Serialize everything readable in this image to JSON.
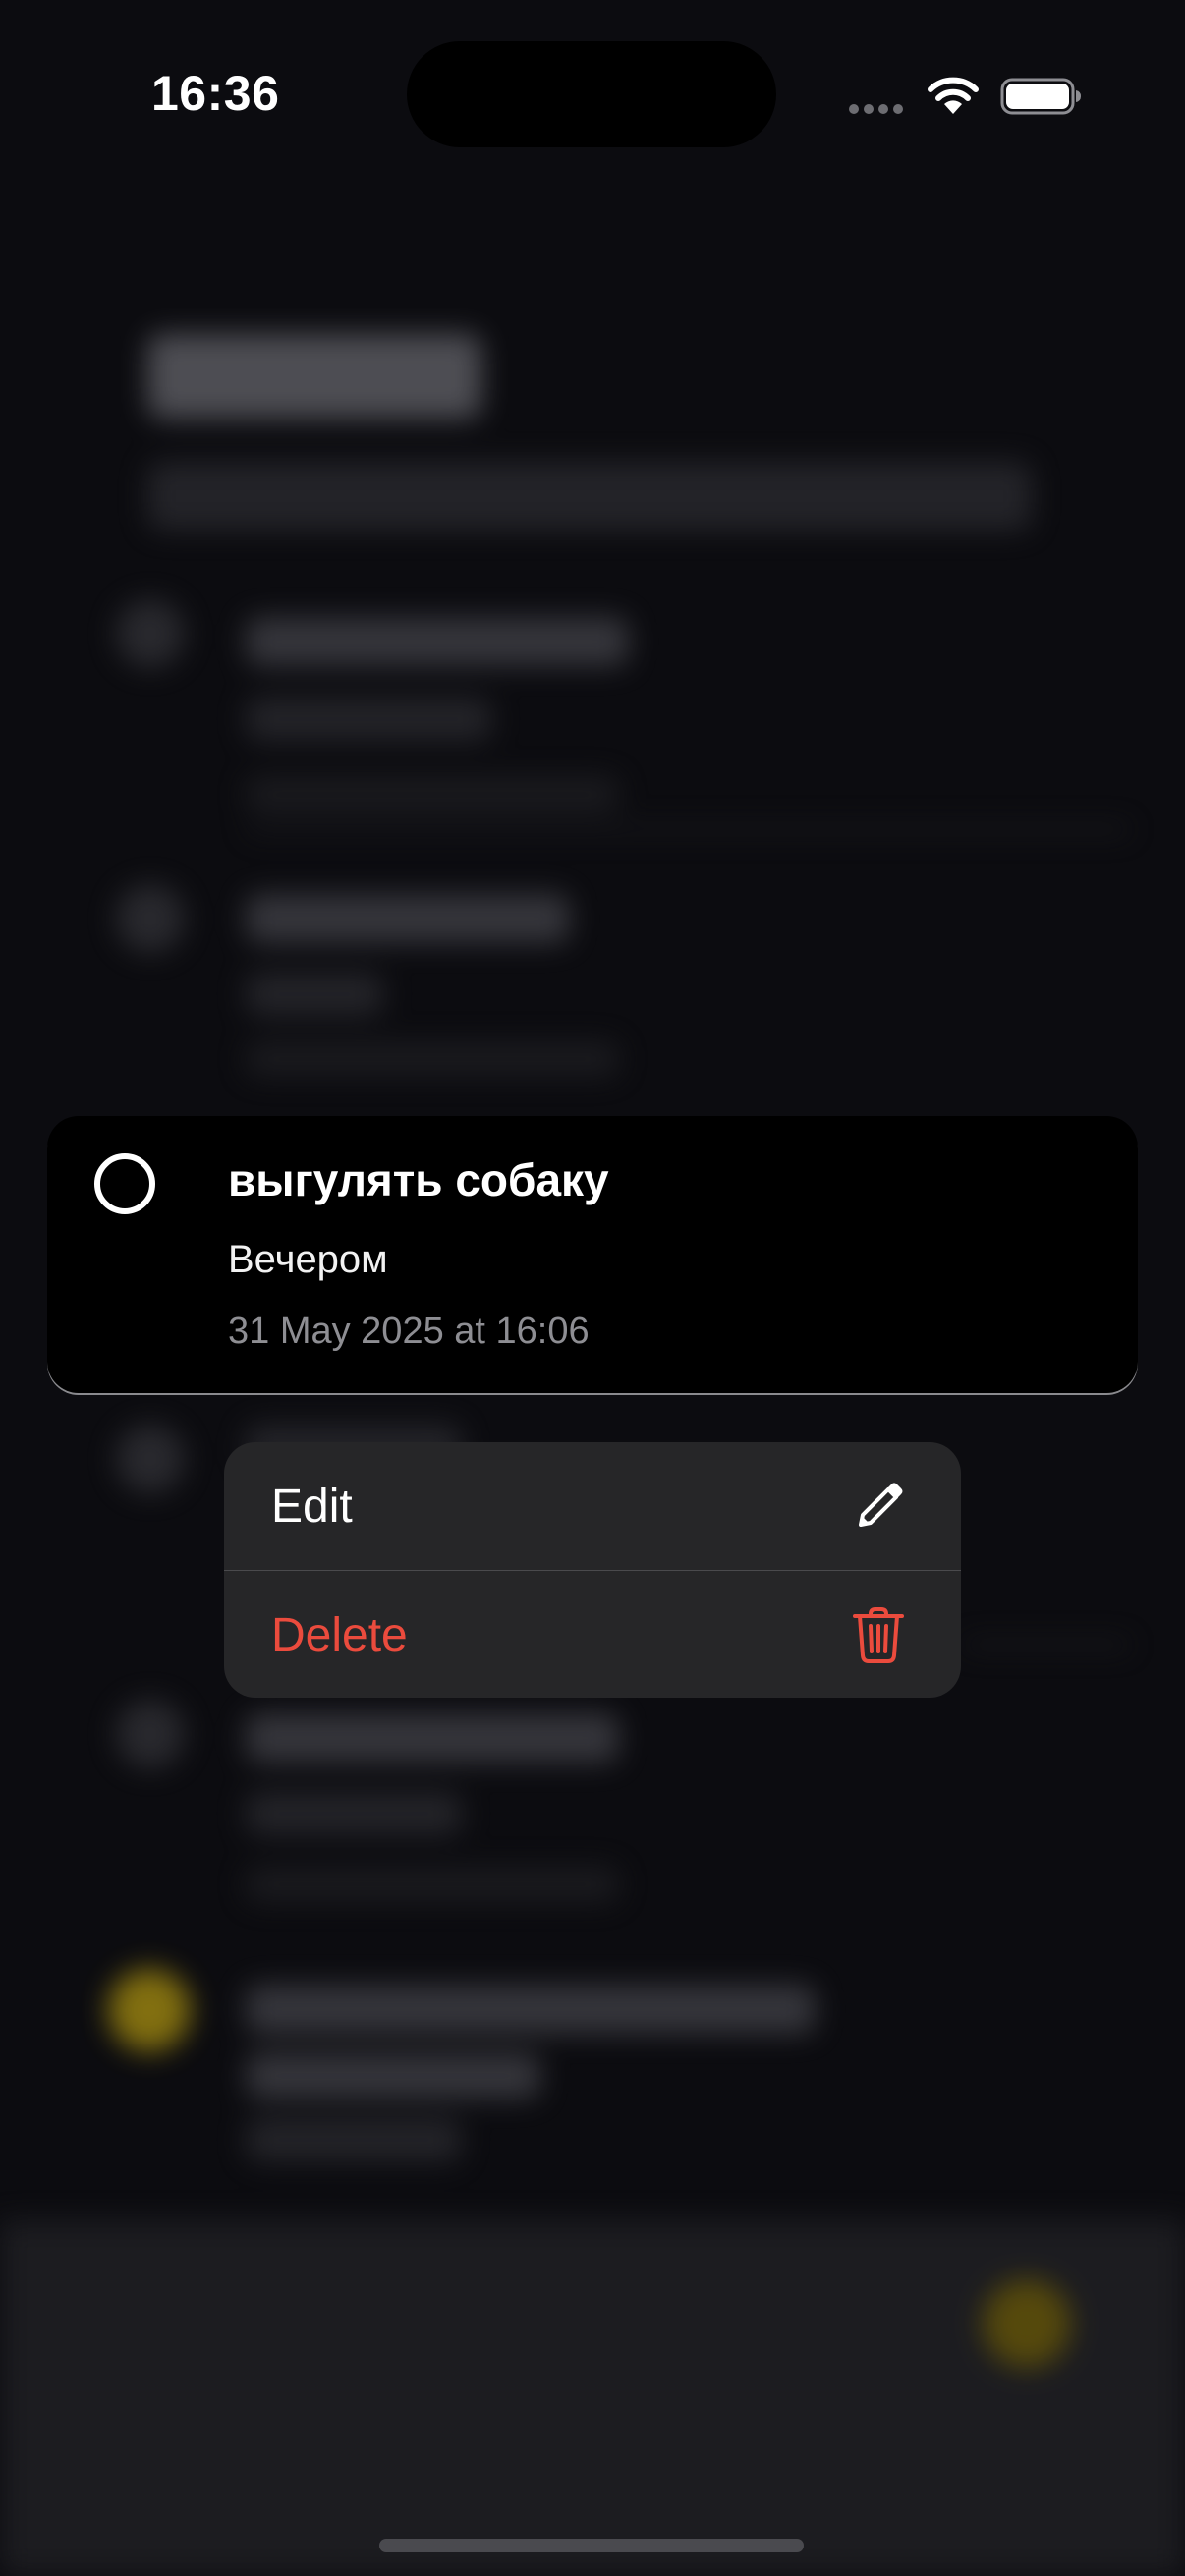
{
  "status_bar": {
    "time": "16:36"
  },
  "task": {
    "title": "выгулять собаку",
    "note": "Вечером",
    "date": "31 May 2025 at 16:06",
    "completed": false
  },
  "context_menu": {
    "items": [
      {
        "label": "Edit",
        "icon": "pencil-icon",
        "destructive": false
      },
      {
        "label": "Delete",
        "icon": "trash-icon",
        "destructive": true
      }
    ]
  },
  "colors": {
    "destructive": "#eb4b3d",
    "accent": "#f5c400",
    "background": "#0c0c10",
    "menu_background": "#262628"
  }
}
